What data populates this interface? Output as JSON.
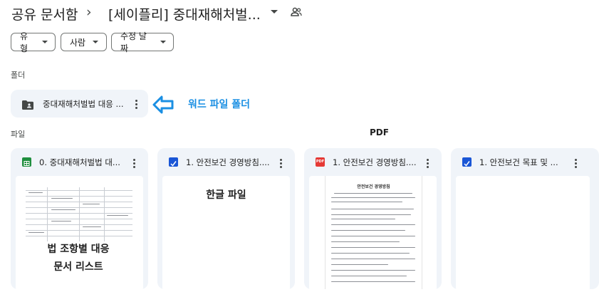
{
  "header": {
    "root": "공유 문서함",
    "separator": "›",
    "current_folder": "[세이플리] 중대재해처벌..."
  },
  "filters": [
    {
      "label": "유형"
    },
    {
      "label": "사람"
    },
    {
      "label": "수정 날짜"
    }
  ],
  "sections": {
    "folders_label": "폴더",
    "files_label": "파일"
  },
  "folder": {
    "name": "중대재해처벌법 대응 ...",
    "icon": "shared-folder-icon"
  },
  "files": [
    {
      "name": "0. 중대재해처벌법 대...",
      "icon": "google-sheets-icon"
    },
    {
      "name": "1. 안전보건 경영방침....",
      "icon": "word-doc-icon"
    },
    {
      "name": "1. 안전보건 경영방침....",
      "icon": "pdf-icon",
      "icon_text": "PDF"
    },
    {
      "name": "1. 안전보건 목표 및 ...",
      "icon": "word-doc-icon"
    }
  ],
  "pdf_preview": {
    "heading": "안전보건 경영방침"
  },
  "annotations": {
    "word_folder": "워드 파일 폴더",
    "pdf": "PDF",
    "hangul_file": "한글 파일",
    "list_line1": "법 조항별 대응",
    "list_line2": "문서 리스트"
  },
  "colors": {
    "card_bg": "#f0f4f9",
    "annotation_blue": "#1a8fe3",
    "sheets_green": "#1e8e3e",
    "word_blue": "#1a56d6",
    "pdf_red": "#e53935"
  }
}
